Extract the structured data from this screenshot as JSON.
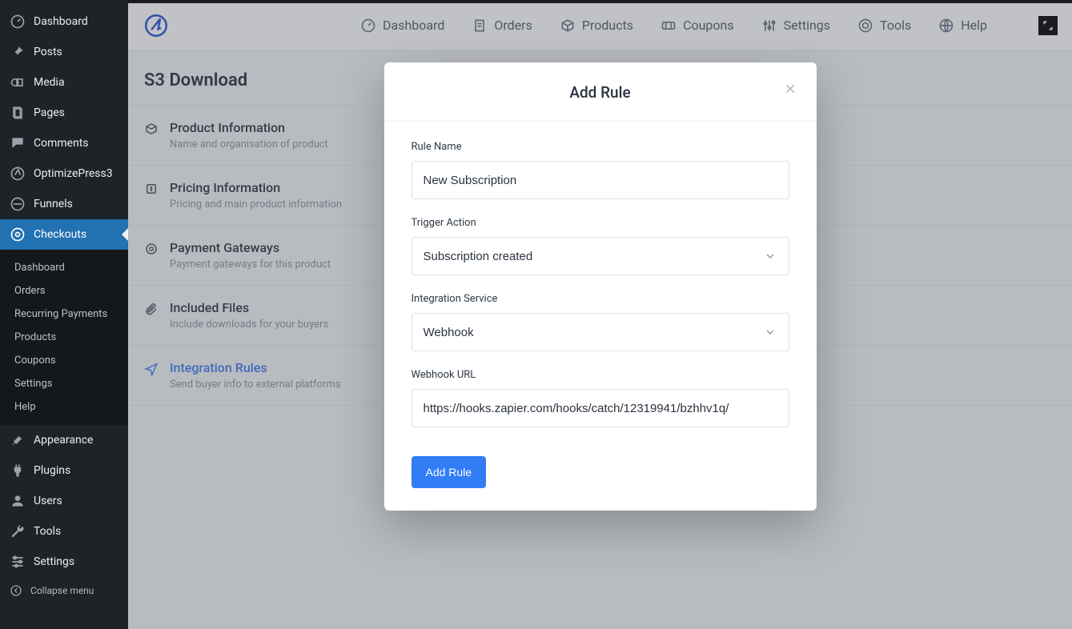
{
  "wp_sidebar": {
    "items": [
      {
        "label": "Dashboard",
        "icon": "gauge"
      },
      {
        "label": "Posts",
        "icon": "pin"
      },
      {
        "label": "Media",
        "icon": "media"
      },
      {
        "label": "Pages",
        "icon": "page"
      },
      {
        "label": "Comments",
        "icon": "comment"
      },
      {
        "label": "OptimizePress3",
        "icon": "optimize"
      },
      {
        "label": "Funnels",
        "icon": "funnel"
      },
      {
        "label": "Checkouts",
        "icon": "checkout",
        "active": true
      }
    ],
    "sub_items": [
      {
        "label": "Dashboard"
      },
      {
        "label": "Orders"
      },
      {
        "label": "Recurring Payments"
      },
      {
        "label": "Products"
      },
      {
        "label": "Coupons"
      },
      {
        "label": "Settings"
      },
      {
        "label": "Help"
      }
    ],
    "lower_items": [
      {
        "label": "Appearance",
        "icon": "brush"
      },
      {
        "label": "Plugins",
        "icon": "plug"
      },
      {
        "label": "Users",
        "icon": "user"
      },
      {
        "label": "Tools",
        "icon": "wrench"
      },
      {
        "label": "Settings",
        "icon": "sliders"
      }
    ],
    "collapse_label": "Collapse menu"
  },
  "topnav": {
    "items": [
      {
        "label": "Dashboard",
        "icon": "gauge"
      },
      {
        "label": "Orders",
        "icon": "clipboard"
      },
      {
        "label": "Products",
        "icon": "box"
      },
      {
        "label": "Coupons",
        "icon": "ticket"
      },
      {
        "label": "Settings",
        "icon": "sliders"
      },
      {
        "label": "Tools",
        "icon": "target"
      },
      {
        "label": "Help",
        "icon": "globe"
      }
    ]
  },
  "page": {
    "title": "S3 Download"
  },
  "sections": [
    {
      "title": "Product Information",
      "desc": "Name and organisation of product",
      "icon": "box"
    },
    {
      "title": "Pricing Information",
      "desc": "Pricing and main product information",
      "icon": "dollar"
    },
    {
      "title": "Payment Gateways",
      "desc": "Payment gateways for this product",
      "icon": "target"
    },
    {
      "title": "Included Files",
      "desc": "Include downloads for your buyers",
      "icon": "clip"
    },
    {
      "title": "Integration Rules",
      "desc": "Send buyer info to external platforms",
      "icon": "send",
      "active": true
    }
  ],
  "modal": {
    "title": "Add Rule",
    "labels": {
      "rule_name": "Rule Name",
      "trigger_action": "Trigger Action",
      "integration_service": "Integration Service",
      "webhook_url": "Webhook URL"
    },
    "values": {
      "rule_name": "New Subscription",
      "trigger_action": "Subscription created",
      "integration_service": "Webhook",
      "webhook_url": "https://hooks.zapier.com/hooks/catch/12319941/bzhhv1q/"
    },
    "submit_label": "Add Rule"
  }
}
